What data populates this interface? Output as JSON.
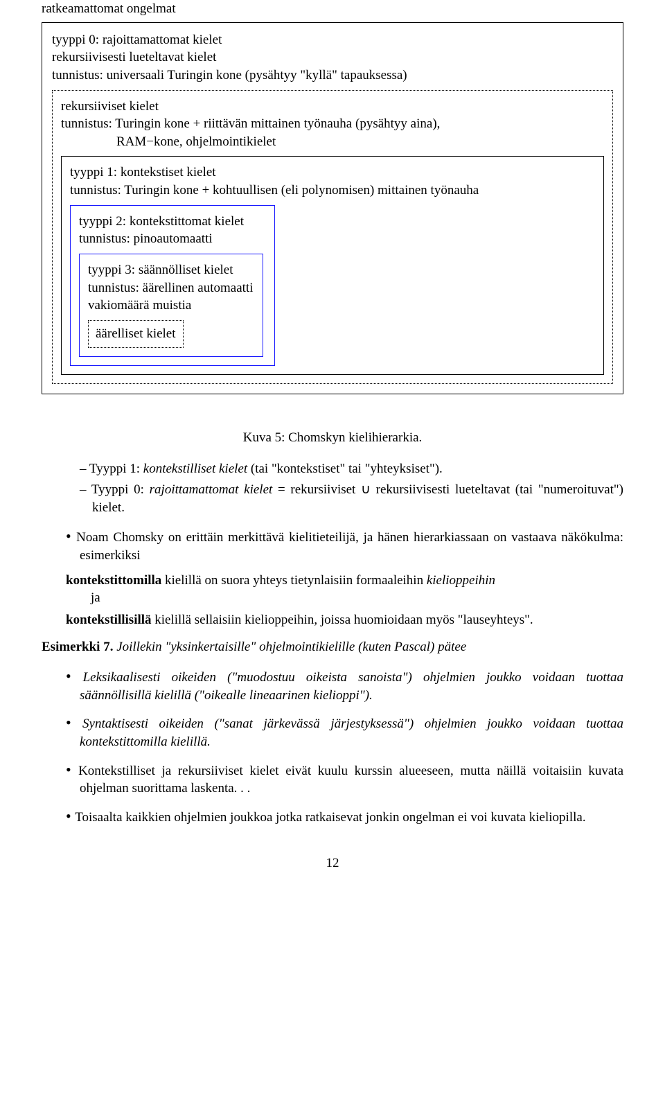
{
  "diagram": {
    "ratkeamattomat": "ratkeamattomat ongelmat",
    "tyyppi0_title": "tyyppi 0: rajoittamattomat kielet",
    "tyyppi0_line2": "rekursiivisesti lueteltavat kielet",
    "tyyppi0_line3": "tunnistus: universaali Turingin kone (pysähtyy \"kyllä\" tapauksessa)",
    "rekursiiviset_title": "rekursiiviset kielet",
    "rekursiiviset_line2": "tunnistus: Turingin kone + riittävän mittainen työnauha (pysähtyy aina),",
    "rekursiiviset_line3": "RAM−kone, ohjelmointikielet",
    "tyyppi1_title": "tyyppi 1: kontekstiset kielet",
    "tyyppi1_line2": "tunnistus: Turingin kone + kohtuullisen (eli polynomisen) mittainen työnauha",
    "tyyppi2_title": "tyyppi 2: kontekstittomat kielet",
    "tyyppi2_line2": "tunnistus: pinoautomaatti",
    "tyyppi3_title": "tyyppi 3: säännölliset kielet",
    "tyyppi3_line2": "tunnistus: äärellinen automaatti",
    "tyyppi3_line3": "vakiomäärä muistia",
    "aarelliset": "äärelliset kielet"
  },
  "caption": "Kuva 5: Chomskyn kielihierarkia.",
  "dash1": {
    "pre": "Tyyppi 1: ",
    "it": "kontekstilliset kielet",
    "post": " (tai \"kontekstiset\" tai \"yhteyksiset\")."
  },
  "dash2": {
    "pre": "Tyyppi 0: ",
    "it": "rajoittamattomat kielet",
    "post": " = rekursiiviset ∪ rekursiivisesti lueteltavat (tai \"numeroituvat\") kielet."
  },
  "bullet_chomsky": "Noam Chomsky on erittäin merkittävä kielitieteilijä, ja hänen hierarkiassaan on vastaava näkökulma: esimerkiksi",
  "def1": {
    "term": "kontekstittomilla",
    "rest": " kielillä on suora yhteys tietynlaisiin formaaleihin ",
    "it": "kielioppeihin",
    "rest2": " ja"
  },
  "def2": {
    "term": "kontekstillisillä",
    "rest": " kielillä sellaisiin kielioppeihin, joissa huomioidaan myös \"lauseyhteys\"."
  },
  "example": {
    "label": "Esimerkki 7.",
    "text": "Joillekin \"yksinkertaisille\" ohjelmointikielille (kuten Pascal) pätee"
  },
  "b1": {
    "t1": "Leksikaalisesti oikeiden (\"muodostuu oikeista sanoista\") ohjelmien joukko voidaan tuottaa säännöllisillä kielillä (\"oikealle lineaarinen kielioppi\")."
  },
  "b2": {
    "t1": "Syntaktisesti oikeiden (\"sanat järkevässä järjestyksessä\") ohjelmien joukko voidaan tuottaa kontekstittomilla kielillä."
  },
  "b3": "Kontekstilliset ja rekursiiviset kielet eivät kuulu kurssin alueeseen, mutta näillä voitaisiin kuvata ohjelman suorittama laskenta. . .",
  "b4": "Toisaalta kaikkien ohjelmien joukkoa jotka ratkaisevat jonkin ongelman ei voi kuvata kieliopilla.",
  "pageno": "12"
}
